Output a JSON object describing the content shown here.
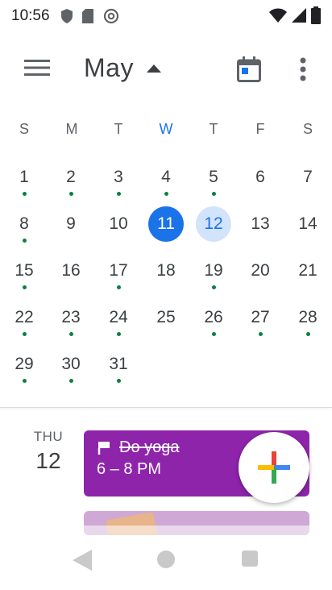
{
  "status_bar": {
    "time": "10:56",
    "icons": [
      "shield-icon",
      "sd-card-icon",
      "at-sign-icon",
      "wifi-icon",
      "signal-icon",
      "battery-icon"
    ]
  },
  "app_bar": {
    "month": "May",
    "menu_icon": "hamburger-icon",
    "dropdown_icon": "caret-up-icon",
    "today_icon": "calendar-today-icon",
    "overflow_icon": "more-vert-icon"
  },
  "calendar": {
    "weekdays": [
      "S",
      "M",
      "T",
      "W",
      "T",
      "F",
      "S"
    ],
    "active_weekday_index": 3,
    "weeks": [
      [
        "1",
        "2",
        "3",
        "4",
        "5",
        "6",
        "7"
      ],
      [
        "8",
        "9",
        "10",
        "11",
        "12",
        "13",
        "14"
      ],
      [
        "15",
        "16",
        "17",
        "18",
        "19",
        "20",
        "21"
      ],
      [
        "22",
        "23",
        "24",
        "25",
        "26",
        "27",
        "28"
      ],
      [
        "29",
        "30",
        "31"
      ]
    ],
    "selected_day": "11",
    "highlighted_day": "12",
    "days_with_events": [
      "1",
      "2",
      "3",
      "4",
      "5",
      "8",
      "15",
      "17",
      "19",
      "22",
      "23",
      "24",
      "26",
      "27",
      "28",
      "29",
      "30",
      "31"
    ],
    "colors": {
      "primary": "#1a73e8",
      "primary_light": "#d2e3fc",
      "event_dot": "#0b8043"
    }
  },
  "agenda": {
    "day_of_week": "THU",
    "date": "12",
    "events": [
      {
        "title": "Do yoga",
        "time": "6 – 8 PM",
        "color": "#8e24aa",
        "completed": true,
        "icon": "check-icon"
      }
    ]
  },
  "fab": {
    "icon": "plus-icon",
    "colors": [
      "#4285f4",
      "#ea4335",
      "#fbbc05",
      "#34a853"
    ]
  },
  "nav_bar": {
    "icons": [
      "back-icon",
      "home-icon",
      "recents-icon"
    ]
  }
}
